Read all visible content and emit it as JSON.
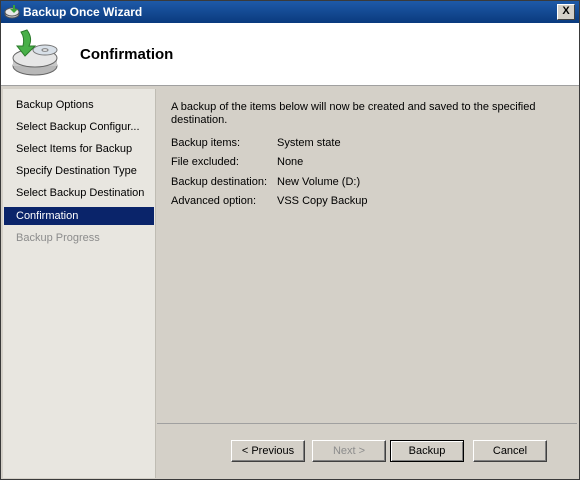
{
  "window": {
    "title": "Backup Once Wizard",
    "close_label": "X"
  },
  "header": {
    "title": "Confirmation"
  },
  "sidebar": {
    "items": [
      {
        "label": "Backup Options"
      },
      {
        "label": "Select Backup Configur..."
      },
      {
        "label": "Select Items for Backup"
      },
      {
        "label": "Specify Destination Type"
      },
      {
        "label": "Select Backup Destination"
      },
      {
        "label": "Confirmation"
      },
      {
        "label": "Backup Progress"
      }
    ]
  },
  "content": {
    "intro": "A backup of the items below will now be created and saved to the specified destination.",
    "rows": [
      {
        "label": "Backup items:",
        "value": "System state"
      },
      {
        "label": "File excluded:",
        "value": "None"
      },
      {
        "label": "Backup destination:",
        "value": "New Volume (D:)"
      },
      {
        "label": "Advanced option:",
        "value": "VSS Copy Backup"
      }
    ]
  },
  "buttons": {
    "previous": "< Previous",
    "next": "Next >",
    "backup": "Backup",
    "cancel": "Cancel"
  }
}
